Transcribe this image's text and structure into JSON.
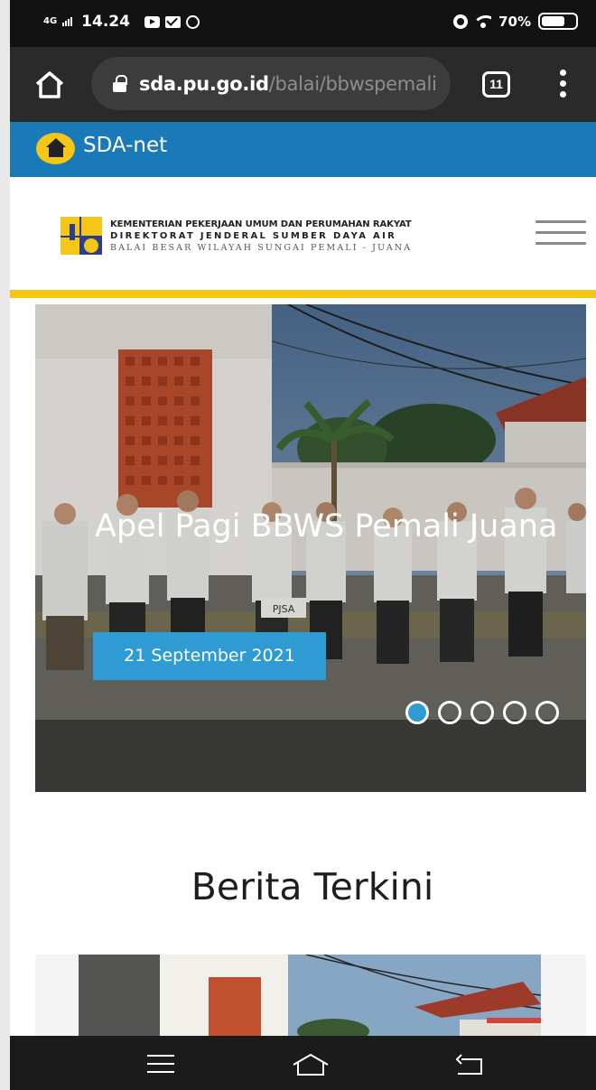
{
  "status_bar": {
    "network": "4G",
    "time": "14.24",
    "battery": "70%",
    "battery_level": 0.7
  },
  "browser": {
    "url_domain": "sda.pu.go.id",
    "url_path": "/balai/bbwspemali",
    "tab_count": "11"
  },
  "sda_bar": {
    "title": "SDA-net"
  },
  "header": {
    "org_line1": "KEMENTERIAN PEKERJAAN UMUM DAN PERUMAHAN RAKYAT",
    "org_line2": "DIREKTORAT JENDERAL SUMBER DAYA AIR",
    "org_line3": "BALAI BESAR WILAYAH SUNGAI PEMALI - JUANA"
  },
  "slider": {
    "title": "Apel Pagi BBWS Pemali Juana",
    "date": "21 September 2021",
    "sign_label": "PJSA",
    "slide_count": 5,
    "active_index": 0
  },
  "news": {
    "section_title": "Berita Terkini"
  },
  "colors": {
    "accent_blue": "#1a7ab8",
    "date_blue": "#2e9bd3",
    "brand_yellow": "#f5c518"
  }
}
